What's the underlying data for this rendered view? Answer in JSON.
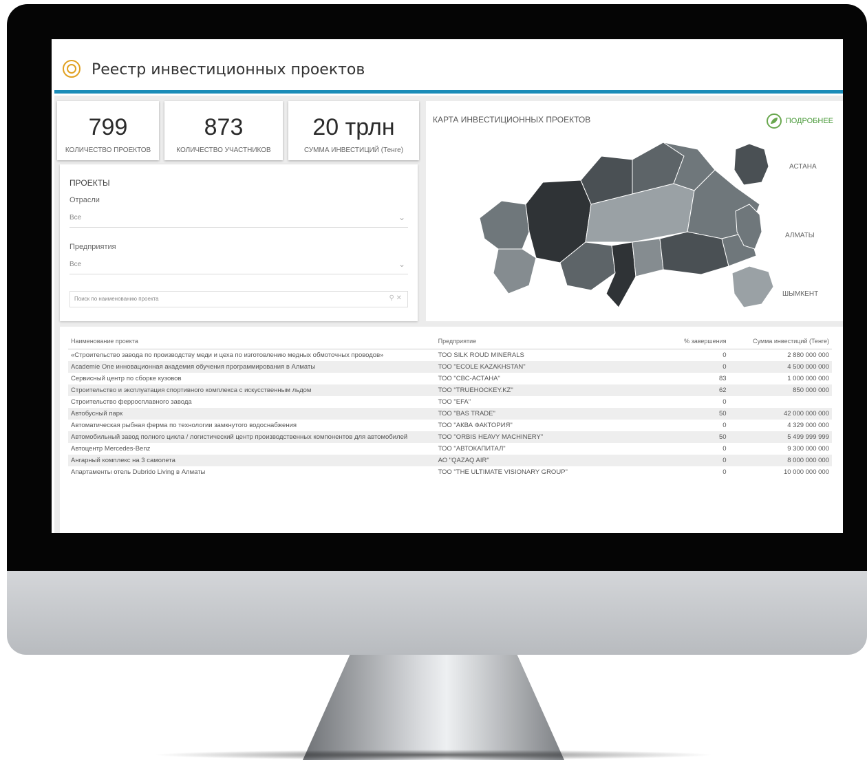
{
  "app": {
    "title": "Реестр инвестиционных проектов"
  },
  "kpis": [
    {
      "value": "799",
      "label": "КОЛИЧЕСТВО ПРОЕКТОВ"
    },
    {
      "value": "873",
      "label": "КОЛИЧЕСТВО УЧАСТНИКОВ"
    },
    {
      "value": "20 трлн",
      "label": "СУММА ИНВЕСТИЦИЙ (Тенге)"
    }
  ],
  "filters": {
    "title": "ПРОЕКТЫ",
    "industry_label": "Отрасли",
    "industry_value": "Все",
    "enterprise_label": "Предприятия",
    "enterprise_value": "Все",
    "search_placeholder": "Поиск по наименованию проекта"
  },
  "map": {
    "title": "КАРТА ИНВЕСТИЦИОННЫХ ПРОЕКТОВ",
    "more_label": "ПОДРОБНЕЕ",
    "cities": [
      "АСТАНА",
      "АЛМАТЫ",
      "ШЫМКЕНТ"
    ],
    "region_colors": [
      "#2f3336",
      "#5d6468",
      "#6f777b",
      "#858c90",
      "#9aa1a5",
      "#4a5054"
    ]
  },
  "table": {
    "headers": [
      "Наименование проекта",
      "Предприятие",
      "% завершения",
      "Сумма инвестиций (Тенге)"
    ],
    "rows": [
      [
        "«Строительство завода по производству меди и цеха по изготовлению медных обмоточных проводов»",
        "ТОО SILK ROUD MINERALS",
        "0",
        "2 880 000 000"
      ],
      [
        "Academie One инновационная академия обучения программирования в Алматы",
        "ТОО \"ECOLE KAZAKHSTAN\"",
        "0",
        "4 500 000 000"
      ],
      [
        "Сервисный центр по сборке кузовов",
        "ТОО \"СВС-АСТАНА\"",
        "83",
        "1 000 000 000"
      ],
      [
        "Строительство и эксплуатация спортивного комплекса с искусственным льдом",
        "ТОО \"TRUEHOCKEY.KZ\"",
        "62",
        "850 000 000"
      ],
      [
        "Строительство ферросплавного завода",
        "ТОО \"EFA\"",
        "0",
        ""
      ],
      [
        "Автобусный парк",
        "ТОО \"BAS TRADE\"",
        "50",
        "42 000 000 000"
      ],
      [
        "Автоматическая рыбная ферма по технологии замкнутого водоснабжения",
        "ТОО \"АКВА ФАКТОРИЯ\"",
        "0",
        "4 329 000 000"
      ],
      [
        "Автомобильный завод полного цикла / логистический центр производственных компонентов для автомобилей",
        "ТОО \"ORBIS HEAVY MACHINERY\"",
        "50",
        "5 499 999 999"
      ],
      [
        "Автоцентр Mercedes-Benz",
        "ТОО \"АВТОКАПИТАЛ\"",
        "0",
        "9 300 000 000"
      ],
      [
        "Ангарный комплекс на 3 самолета",
        "АО \"QAZAQ AIR\"",
        "0",
        "8 000 000 000"
      ],
      [
        "Апартаменты отель Dubrido Living в Алматы",
        "ТОО \"THE ULTIMATE VISIONARY GROUP\"",
        "0",
        "10 000 000 000"
      ]
    ]
  }
}
